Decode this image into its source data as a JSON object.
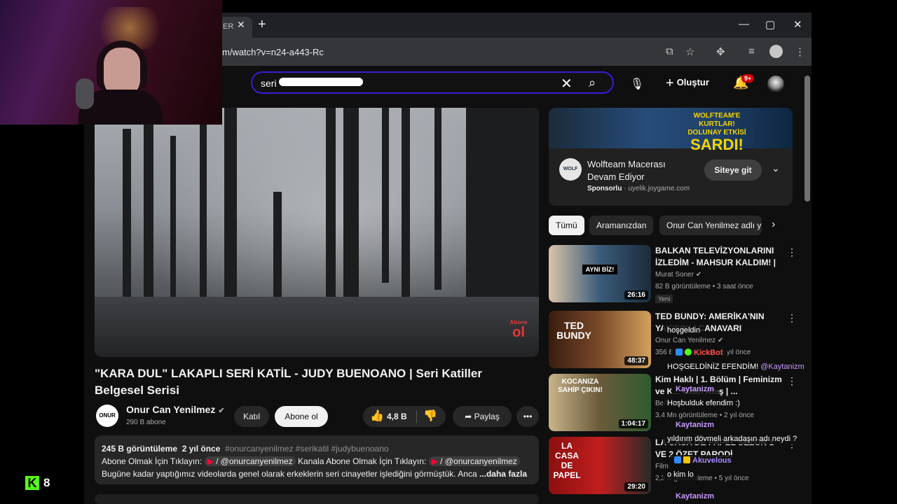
{
  "browser": {
    "tab_title": "ER",
    "url": "m/watch?v=n24-a443-Rc",
    "new_tab_icon": "plus-icon",
    "window_controls": [
      "—",
      "▢",
      "✕"
    ]
  },
  "header": {
    "search_value": "seri",
    "create_label": "Oluştur",
    "notif_count": "9+"
  },
  "video": {
    "watermark_top": "Abone",
    "watermark_bottom": "ol",
    "title": "\"KARA DUL\" LAKAPLI SERİ KATİL - JUDY BUENOANO | Seri Katiller Belgesel Serisi"
  },
  "channel": {
    "logo_text": "ONUR CAN",
    "name": "Onur Can Yenilmez",
    "subs": "290 B abone",
    "join_label": "Katıl",
    "subscribe_label": "Abone ol",
    "likes": "4,8 B",
    "share_label": "Paylaş",
    "more_icon": "more-horiz-icon"
  },
  "description": {
    "views": "245 B görüntüleme",
    "date": "2 yıl önce",
    "hashtags": "#onurcanyenilmez #serikatil #judybuenoano",
    "line2_a": "Abone Olmak İçin Tıklayın:",
    "mention1": "/ @onurcanyenilmez",
    "line2_b": "Kanala Abone Olmak İçin Tıklayın:",
    "mention2": "/ @onurcanyenilmez",
    "line3": "Bugüne kadar yaptığımız videolarda genel olarak erkeklerin seri cinayetler işlediğini görmüştük. Anca",
    "more_label": "...daha fazla"
  },
  "ad": {
    "banner_top": "WOLFTEAM'E KURTLAR!",
    "banner_mid": "DOLUNAY ETKİSİ",
    "banner_big": "SARDI!",
    "logo_text": "WOLF",
    "title": "Wolfteam Macerası Devam Ediyor",
    "sponsored": "Sponsorlu",
    "domain": "· uyelik.joygame.com",
    "cta": "Siteye git"
  },
  "chips": [
    "Tümü",
    "Aramanızdan",
    "Onur Can Yenilmez adlı y"
  ],
  "recommendations": [
    {
      "title": "BALKAN TELEVİZYONLARINI İZLEDİM - MAHSUR KALDIM! | ...",
      "channel": "Murat Soner",
      "meta": "82 B görüntüleme • 3 saat önce",
      "badge": "Yeni",
      "duration": "26:16",
      "thumb_text": "AYNI BİZ!"
    },
    {
      "title": "TED BUNDY: AMERİKA'NIN YAKIŞIKLI CANAVARI",
      "channel": "Onur Can Yenilmez",
      "meta": "356 B görüntüleme • 2 yıl önce",
      "badge": "",
      "duration": "48:37",
      "thumb_text": "TED BUNDY"
    },
    {
      "title": "Kim Haklı | 1. Bölüm | Feminizm ve K... Okan Ateş | ...",
      "channel": "BeIN",
      "meta": "3,4 Mn görüntüleme • 2 yıl önce",
      "badge": "",
      "duration": "1:04:17",
      "thumb_text": "KOCANIZA SAHİP ÇIKIN!"
    },
    {
      "title": "LA CASA DE PAPEL SEZON 1 VE 2 ÖZET PARODİ",
      "channel": "Film",
      "meta": "2,3 B görüntüleme • 5 yıl önce",
      "badge": "",
      "duration": "29:20",
      "thumb_text": "LA CASA DE PAPEL"
    }
  ],
  "kick": {
    "letter": "K",
    "viewers": "8"
  },
  "chat": [
    {
      "user": "",
      "text": "hoşgeldin"
    },
    {
      "user": "KickBot",
      "text": ""
    },
    {
      "user": "",
      "text": "HOŞGELDİNİZ EFENDİM!",
      "mention": "@Kaytanizm"
    },
    {
      "user": "Kaytanizm",
      "text": ""
    },
    {
      "user": "",
      "text": "Hoşbulduk efendim :)"
    },
    {
      "user": "Kaytanizm",
      "text": ""
    },
    {
      "user": "",
      "text": "yıldırım dövmeli arkadaşın adı neydi ?"
    },
    {
      "user": "Akuvelous",
      "text": ""
    },
    {
      "user": "",
      "text": "o kim lo"
    },
    {
      "user": "Kaytanizm",
      "text": ""
    }
  ]
}
